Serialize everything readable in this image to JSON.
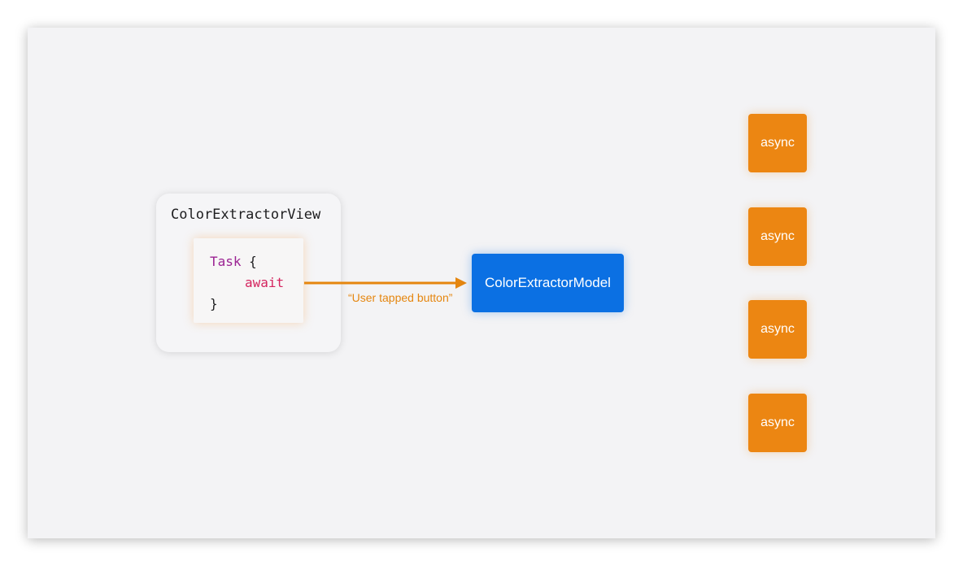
{
  "view": {
    "title": "ColorExtractorView",
    "code": {
      "keyword_task": "Task",
      "open_brace": " {",
      "keyword_await": "await",
      "close_brace": "}"
    }
  },
  "arrow": {
    "label": "“User tapped button”"
  },
  "model": {
    "label": "ColorExtractorModel"
  },
  "async_boxes": [
    {
      "label": "async"
    },
    {
      "label": "async"
    },
    {
      "label": "async"
    },
    {
      "label": "async"
    }
  ],
  "colors": {
    "slide_background": "#f3f3f5",
    "model_blue": "#0b70e3",
    "async_orange": "#ec8612",
    "arrow_orange": "#e5860f",
    "keyword_task": "#9b2393",
    "keyword_await": "#d4245e"
  }
}
